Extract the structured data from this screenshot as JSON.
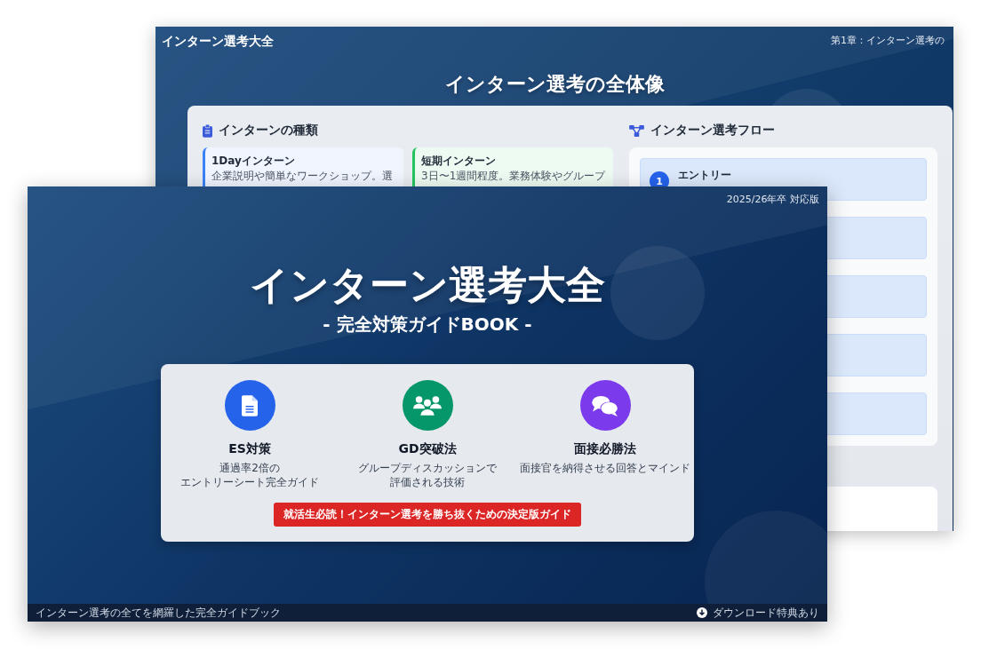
{
  "back_slide": {
    "brand": "インターン選考大全",
    "chapter": "第1章：インターン選考の",
    "heading": "インターン選考の全体像",
    "types_section": {
      "title": "インターンの種類",
      "cards": [
        {
          "title": "1Dayインターン",
          "description": "企業説明や簡単なワークショップ。選",
          "color": "#3b82f6"
        },
        {
          "title": "短期インターン",
          "description": "3日〜1週間程度。業務体験やグループ",
          "color": "#22c55e"
        }
      ]
    },
    "flow_section": {
      "title": "インターン選考フロー",
      "steps": [
        {
          "kind": "labeled",
          "number": "1",
          "title": "エントリー"
        },
        {
          "kind": "covered"
        },
        {
          "kind": "covered"
        },
        {
          "kind": "covered"
        },
        {
          "kind": "covered"
        }
      ]
    }
  },
  "front_slide": {
    "edition": "2025/26年卒 対応版",
    "title": "インターン選考大全",
    "subtitle": "- 完全対策ガイドBOOK -",
    "features": [
      {
        "title": "ES対策",
        "description": "通過率2倍のエントリーシート完全ガイド",
        "color": "#2563eb"
      },
      {
        "title": "GD突破法",
        "description": "グループディスカッションで評価される技術",
        "color": "#059669"
      },
      {
        "title": "面接必勝法",
        "description": "面接官を納得させる回答とマインド",
        "color": "#7c3aed"
      }
    ],
    "cta": "就活生必読！インターン選考を勝ち抜くための決定版ガイド",
    "footer": {
      "text": "インターン選考の全てを網羅した完全ガイドブック",
      "note": "ダウンロード特典あり"
    }
  }
}
